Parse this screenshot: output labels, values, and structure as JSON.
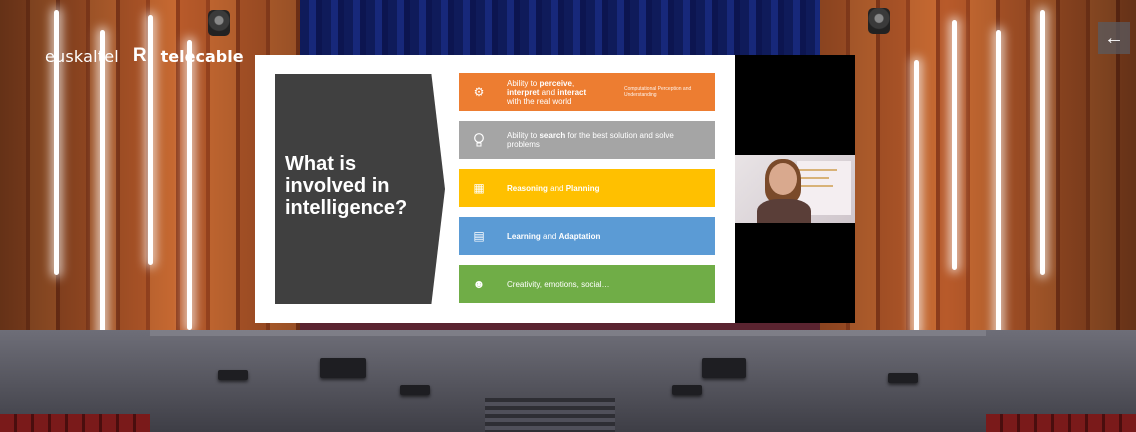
{
  "brand": {
    "logo_left": "euskaltel",
    "logo_mark": "R",
    "logo_right": "telecable"
  },
  "nav": {
    "back_icon": "arrow-left-icon",
    "back_symbol": "←"
  },
  "slide": {
    "title": "What is involved in intelligence?",
    "items": [
      {
        "icon": "head-gear-icon",
        "symbol": "⚙",
        "pre": "Ability to ",
        "b1": "perceive",
        "mid1": ", ",
        "b2": "interpret",
        "mid2": " and ",
        "b3": "interact",
        "post": " with the real world",
        "sub": "Computational Perception and Understanding",
        "color": "#ed7d31"
      },
      {
        "icon": "lightbulb-icon",
        "symbol": "💡",
        "pre": "Ability to ",
        "b1": "search",
        "post": " for the best solution and solve problems",
        "color": "#a5a5a5"
      },
      {
        "icon": "flowchart-icon",
        "symbol": "▦",
        "b1": "Reasoning",
        "mid1": " and ",
        "b2": "Planning",
        "color": "#ffc000"
      },
      {
        "icon": "presentation-icon",
        "symbol": "▤",
        "b1": "Learning",
        "mid1": " and ",
        "b2": "Adaptation",
        "color": "#5b9bd5"
      },
      {
        "icon": "smiley-icon",
        "symbol": "☻",
        "post": "Creativity, emotions, social…",
        "color": "#70ad47"
      }
    ]
  },
  "colors": {
    "curtain": "#17287a",
    "wood": "#b85a2a"
  }
}
